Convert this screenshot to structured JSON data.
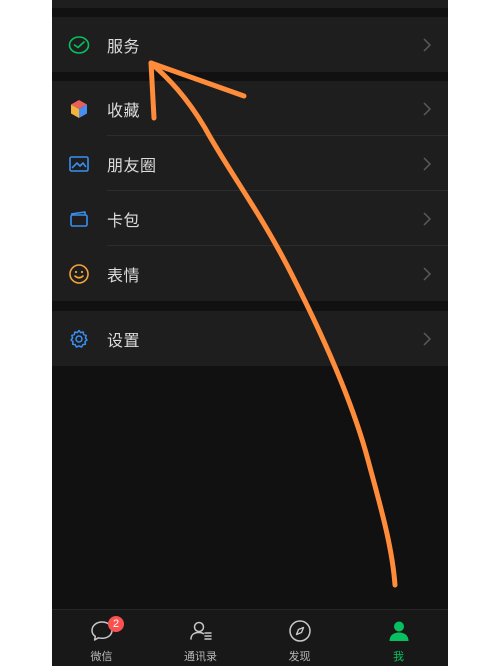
{
  "colors": {
    "background": "#111111",
    "cell": "#1e1e1e",
    "accent": "#07c160",
    "annotation": "#ff8c3a",
    "badge": "#fa5151"
  },
  "menu": {
    "service": {
      "label": "服务",
      "icon": "service-check-icon"
    },
    "favorites": {
      "label": "收藏",
      "icon": "cube-icon"
    },
    "moments": {
      "label": "朋友圈",
      "icon": "photo-icon"
    },
    "cards": {
      "label": "卡包",
      "icon": "card-icon"
    },
    "stickers": {
      "label": "表情",
      "icon": "smiley-icon"
    },
    "settings": {
      "label": "设置",
      "icon": "gear-icon"
    }
  },
  "tabbar": {
    "chats": {
      "label": "微信",
      "badge": "2",
      "icon": "chat-bubble-icon"
    },
    "contacts": {
      "label": "通讯录",
      "icon": "contacts-icon"
    },
    "discover": {
      "label": "发现",
      "icon": "compass-icon"
    },
    "me": {
      "label": "我",
      "icon": "person-icon",
      "active": true
    }
  }
}
